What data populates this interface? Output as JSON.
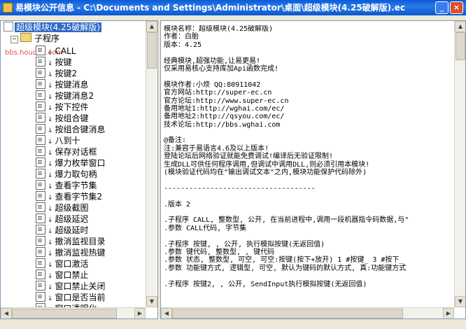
{
  "window": {
    "title": "易模块公开信息 - C:\\Documents and Settings\\Administrator\\桌面\\超级模块(4.25破解版).ec",
    "min_symbol": "_",
    "close_symbol": "×",
    "watermark": "bbs.houdao.com"
  },
  "tree": {
    "root_label": "超级模块(4.25破解版)",
    "folder_label": "子程序",
    "items": [
      "CALL",
      "按键",
      "按键2",
      "按键消息",
      "按键消息2",
      "按下控件",
      "按组合键",
      "按组合键消息",
      "八到十",
      "保存对话框",
      "爆力枚举窗口",
      "爆力取句柄",
      "查看字节集",
      "查看字节集2",
      "超级截图",
      "超级延迟",
      "超级延时",
      "撤消监视目录",
      "撤消监视热键",
      "窗口激活",
      "窗口禁止",
      "窗口禁止关闭",
      "窗口是否当前",
      "窗口透明化"
    ]
  },
  "content": {
    "lines": [
      "模块名称：超级模块(4.25破解版)",
      "作者：白胎",
      "版本：4.25",
      "",
      "经典模块,超强功能,让易更易!",
      "仅采用易核心支持库加Api函数完成!",
      "",
      "模块作者:小烦 QQ:80911042",
      "官方网站:http://super-ec.cn",
      "官方论坛:http://www.super-ec.cn",
      "备用地址1:http://wghai.com/ec/",
      "备用地址2:http://qsyou.com/ec/",
      "技术论坛:http://bbs.wghai.com",
      "",
      "@备注:",
      "注:兼容于易语言4.6及以上版本!",
      "登陆论坛后网络验证就能免费调试!编译后无验证限制!",
      "生成DLL可供任何程序调用,但调试中调用DLL,则必须引用本模块!",
      "(模块验证代码均在\"输出调试文本\"之内,模块功能保护代码除外)",
      "",
      "------------------------------------",
      "",
      ".版本 2",
      "",
      ".子程序 CALL, 整数型, 公开, 在当前进程中,调用一段机器指令码数据,与\"",
      ".参数 CALL代码, 字节集",
      "",
      ".子程序 按键, , 公开, 执行模拟按键(无返回值)",
      ".参数 键代码, 整数型, , 键代码",
      ".参数 状态, 整数型, 可空, 可空:按键(按下+放开) 1 #按键_ 3 #按下_",
      ".参数 功能键方式, 逻辑型, 可空, 默认为键码的默认方式, 真:功能键方式",
      "",
      ".子程序 按键2, , 公开, SendInput执行模拟按键(无返回值)"
    ]
  }
}
